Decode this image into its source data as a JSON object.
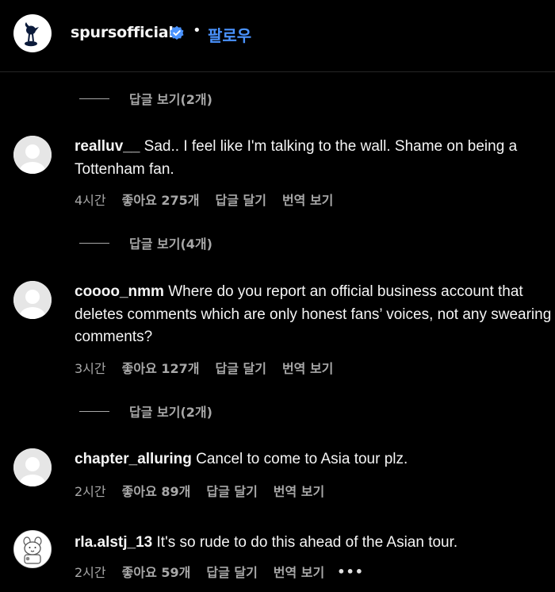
{
  "header": {
    "username": "spursofficial",
    "separator": "•",
    "follow_label": "팔로우"
  },
  "threads": [
    {
      "view_replies": "답글 보기(2개)"
    },
    {
      "comment": {
        "username": "realluv__",
        "text": " Sad.. I feel like I'm talking to the wall. Shame on being a Tottenham fan.",
        "time": "4시간",
        "likes": "좋아요 275개",
        "reply": "답글 달기",
        "translate": "번역 보기"
      },
      "view_replies": "답글 보기(4개)"
    },
    {
      "comment": {
        "username": "coooo_nmm",
        "text": " Where do you report an official business account that deletes comments which are only honest fans’ voices, not any swearing comments?",
        "time": "3시간",
        "likes": "좋아요 127개",
        "reply": "답글 달기",
        "translate": "번역 보기"
      },
      "view_replies": "답글 보기(2개)"
    },
    {
      "comment": {
        "username": "chapter_alluring",
        "text": " Cancel to come to Asia tour plz.",
        "time": "2시간",
        "likes": "좋아요 89개",
        "reply": "답글 달기",
        "translate": "번역 보기"
      }
    },
    {
      "comment": {
        "username": "rla.alstj_13",
        "text": " It's so rude to do this ahead of the Asian tour.",
        "time": "2시간",
        "likes": "좋아요 59개",
        "reply": "답글 달기",
        "translate": "번역 보기",
        "more": "•••"
      }
    }
  ],
  "colors": {
    "background": "#000000",
    "text": "#f5f5f5",
    "secondary": "#a8a8a8",
    "link_blue": "#4a93ff",
    "verified_blue": "#4a93ff"
  }
}
